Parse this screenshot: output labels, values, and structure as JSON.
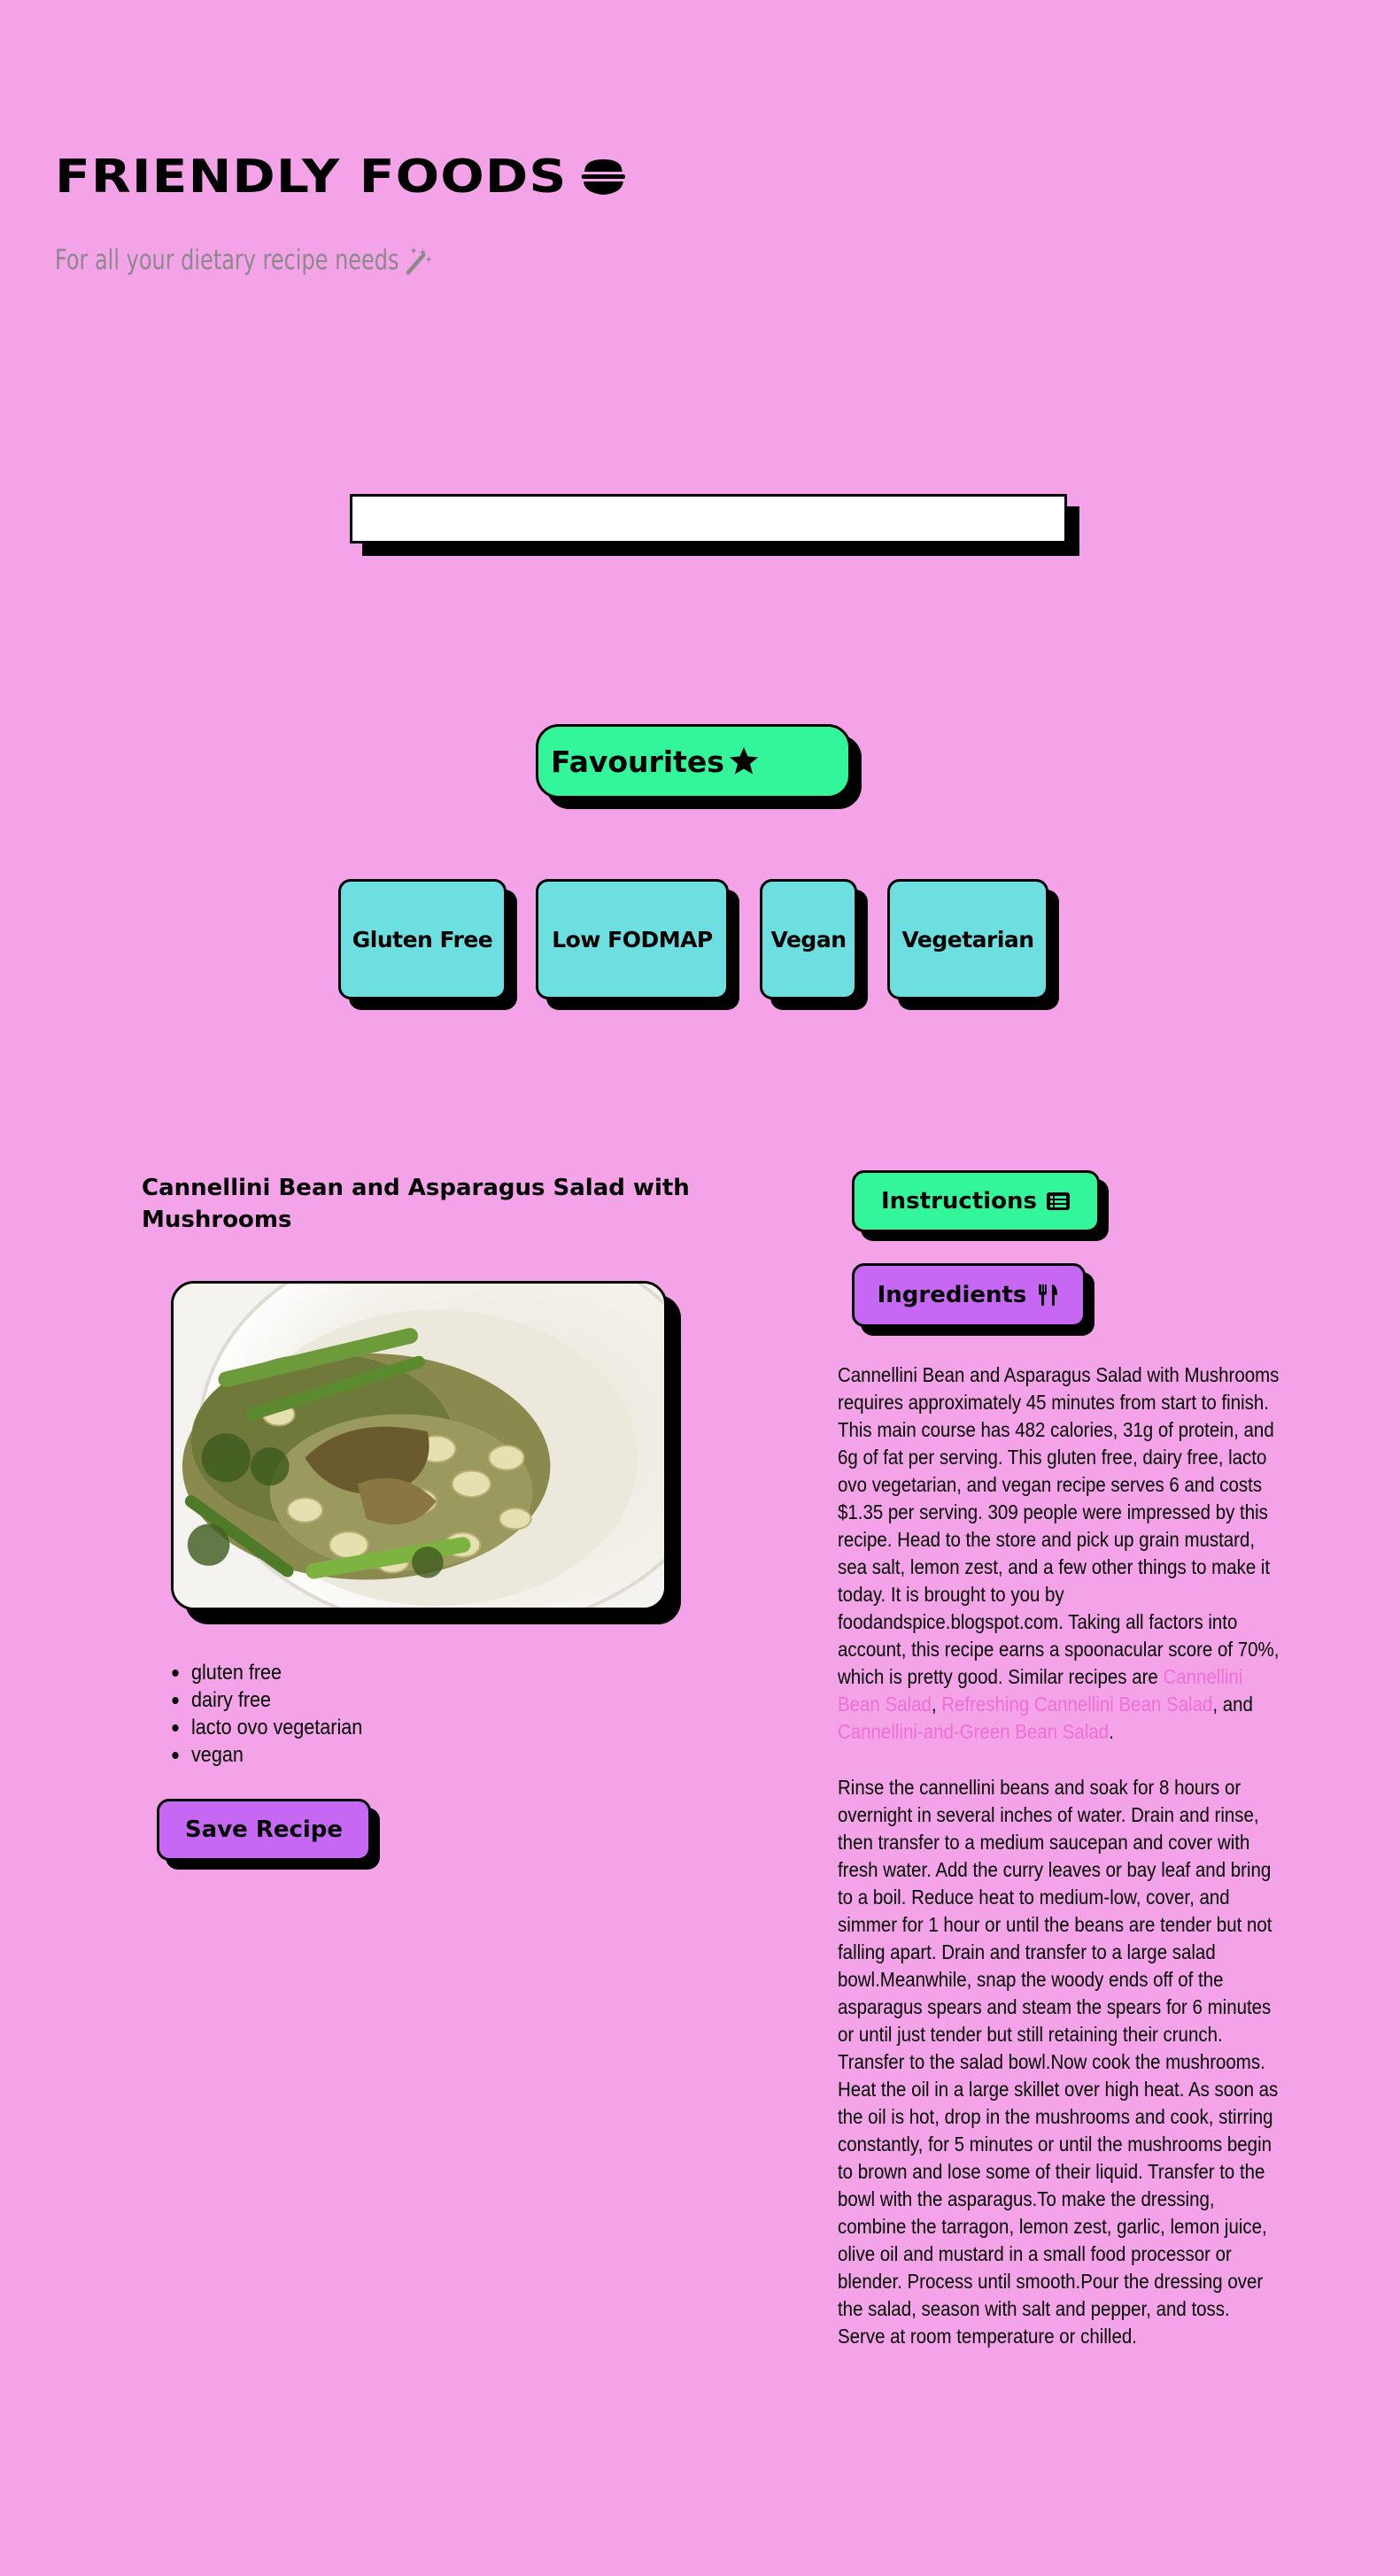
{
  "header": {
    "title": "FRIENDLY FOODS",
    "title_icon": "bowl-food-icon",
    "tagline": "For all your dietary recipe needs",
    "tagline_icon": "magic-wand-icon"
  },
  "search": {
    "value": "",
    "placeholder": ""
  },
  "favourites": {
    "label": "Favourites",
    "icon": "star-icon",
    "color": "#33f59a"
  },
  "filters": [
    {
      "label": "Gluten Free"
    },
    {
      "label": "Low FODMAP"
    },
    {
      "label": "Vegan"
    },
    {
      "label": "Vegetarian"
    }
  ],
  "filter_color": "#6ddfe0",
  "recipe": {
    "title": "Cannellini Bean and Asparagus Salad with Mushrooms",
    "image_alt": "Cannellini Bean and Asparagus Salad with Mushrooms",
    "diets": [
      "gluten free",
      "dairy free",
      "lacto ovo vegetarian",
      "vegan"
    ],
    "save_label": "Save Recipe",
    "instructions_label": "Instructions",
    "instructions_icon": "list-icon",
    "ingredients_label": "Ingredients",
    "ingredients_icon": "utensils-icon",
    "summary_text": "Cannellini Bean and Asparagus Salad with Mushrooms requires approximately 45 minutes from start to finish. This main course has 482 calories, 31g of protein, and 6g of fat per serving. This gluten free, dairy free, lacto ovo vegetarian, and vegan recipe serves 6 and costs $1.35 per serving. 309 people were impressed by this recipe. Head to the store and pick up grain mustard, sea salt, lemon zest, and a few other things to make it today. It is brought to you by foodandspice.blogspot.com. Taking all factors into account, this recipe earns a spoonacular score of 70%, which is pretty good. Similar recipes are ",
    "similar_1": "Cannellini Bean Salad",
    "sep_1": ", ",
    "similar_2": "Refreshing Cannellini Bean Salad",
    "sep_2": ", and ",
    "similar_3": "Cannellini-and-Green Bean Salad",
    "sep_3": ".",
    "instructions_text": "Rinse the cannellini beans and soak for 8 hours or overnight in several inches of water. Drain and rinse, then transfer to a medium saucepan and cover with fresh water. Add the curry leaves or bay leaf and bring to a boil. Reduce heat to medium-low, cover, and simmer for 1 hour or until the beans are tender but not falling apart. Drain and transfer to a large salad bowl.Meanwhile, snap the woody ends off of the asparagus spears and steam the spears for 6 minutes or until just tender but still retaining their crunch. Transfer to the salad bowl.Now cook the mushrooms. Heat the oil in a large skillet over high heat. As soon as the oil is hot, drop in the mushrooms and cook, stirring constantly, for 5 minutes or until the mushrooms begin to brown and lose some of their liquid. Transfer to the bowl with the asparagus.To make the dressing, combine the tarragon, lemon zest, garlic, lemon juice, olive oil and mustard in a small food processor or blender. Process until smooth.Pour the dressing over the salad, season with salt and pepper, and toss. Serve at room temperature or chilled."
  },
  "colors": {
    "background": "#f4a3e8",
    "green": "#33f59a",
    "cyan": "#6ddfe0",
    "purple": "#c768f5",
    "link": "#ef6fd6"
  }
}
